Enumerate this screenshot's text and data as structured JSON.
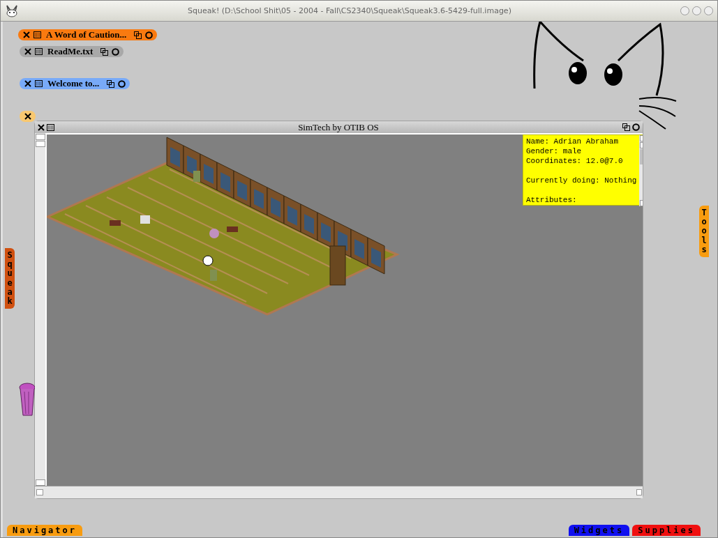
{
  "window": {
    "title": "Squeak! (D:\\School Shit\\05 - 2004 - Fall\\CS2340\\Squeak\\Squeak3.6-5429-full.image)"
  },
  "collapsed_windows": [
    {
      "title": "A Word of Caution...",
      "color": "#f97a10"
    },
    {
      "title": "ReadMe.txt",
      "color": "#a8a8a8"
    },
    {
      "title": "Welcome to...",
      "color": "#78aaf8"
    },
    {
      "color": "#f8c870"
    }
  ],
  "sim_window": {
    "title": "SimTech by OTIB OS",
    "info_panel": {
      "lines": [
        {
          "text": "Name: Adrian Abraham",
          "space_before": false
        },
        {
          "text": "Gender: male",
          "space_before": false
        },
        {
          "text": "Coordinates: 12.0@7.0",
          "space_before": false
        },
        {
          "text": "Currently doing: Nothing",
          "space_before": true
        },
        {
          "text": "Attributes:",
          "space_before": true
        }
      ]
    }
  },
  "flaps": [
    {
      "label": "Squeak",
      "kind": "vertical",
      "color": "#d05010"
    },
    {
      "label": "Tools",
      "kind": "vertical",
      "color": "#f89c10"
    },
    {
      "label": "Navigator",
      "kind": "horizontal",
      "color": "#f89c10"
    },
    {
      "label": "Widgets",
      "kind": "horizontal",
      "color": "#1010f0"
    },
    {
      "label": "Supplies",
      "kind": "horizontal",
      "color": "#f01010"
    }
  ]
}
